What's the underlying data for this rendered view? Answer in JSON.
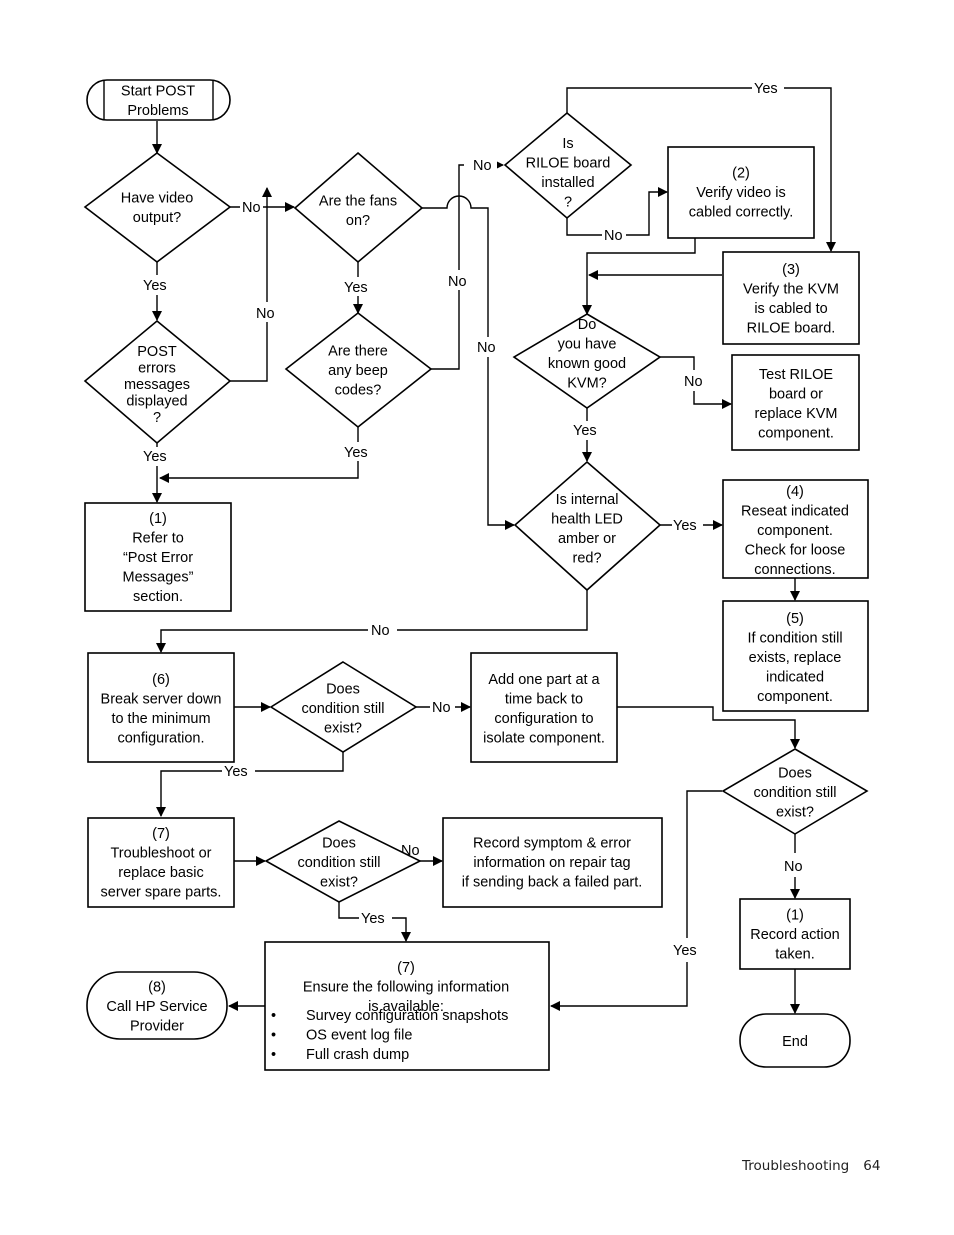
{
  "nodes": {
    "start": {
      "type": "terminator",
      "lines": [
        "Start POST",
        "Problems"
      ]
    },
    "q_video": {
      "type": "decision",
      "lines": [
        "Have video",
        "output?"
      ]
    },
    "q_fans": {
      "type": "decision",
      "lines": [
        "Are the fans",
        "on?"
      ]
    },
    "q_riloe": {
      "type": "decision",
      "lines": [
        "Is",
        "RILOE board",
        "installed",
        "?"
      ]
    },
    "step2": {
      "type": "process",
      "lines": [
        "(2)",
        "Verify video is",
        "cabled correctly."
      ]
    },
    "step3": {
      "type": "process",
      "lines": [
        "(3)",
        "Verify the KVM",
        "is cabled to",
        "RILOE board."
      ]
    },
    "q_post_errors": {
      "type": "decision",
      "lines": [
        "POST",
        "errors",
        "messages",
        "displayed",
        "?"
      ]
    },
    "q_beep": {
      "type": "decision",
      "lines": [
        "Are there",
        "any beep",
        "codes?"
      ]
    },
    "q_kvm": {
      "type": "decision",
      "lines": [
        "Do",
        "you have",
        "known good",
        "KVM?"
      ]
    },
    "test_riloe": {
      "type": "process",
      "lines": [
        "Test RILOE",
        "board or",
        "replace KVM",
        "component."
      ]
    },
    "step1_refer": {
      "type": "process",
      "lines": [
        "(1)",
        "Refer to",
        "“Post Error",
        "Messages”",
        "section."
      ]
    },
    "q_led": {
      "type": "decision",
      "lines": [
        "Is internal",
        "health LED",
        "amber or",
        "red?"
      ]
    },
    "step4": {
      "type": "process",
      "lines": [
        "(4)",
        "Reseat indicated",
        "component.",
        "Check for loose",
        "connections."
      ]
    },
    "step5": {
      "type": "process",
      "lines": [
        "(5)",
        "If condition still",
        "exists, replace",
        "indicated",
        "component."
      ]
    },
    "step6": {
      "type": "process",
      "lines": [
        "(6)",
        "Break server down",
        "to the minimum",
        "configuration."
      ]
    },
    "q_cond1": {
      "type": "decision",
      "lines": [
        "Does",
        "condition still",
        "exist?"
      ]
    },
    "add_part": {
      "type": "process",
      "lines": [
        "Add one part at a",
        "time back to",
        "configuration to",
        "isolate component."
      ]
    },
    "q_cond2": {
      "type": "decision",
      "lines": [
        "Does",
        "condition still",
        "exist?"
      ]
    },
    "step7_troubleshoot": {
      "type": "process",
      "lines": [
        "(7)",
        "Troubleshoot or",
        "replace basic",
        "server spare parts."
      ]
    },
    "q_cond3": {
      "type": "decision",
      "lines": [
        "Does",
        "condition still",
        "exist?"
      ]
    },
    "record_symptom": {
      "type": "process",
      "lines": [
        "Record symptom & error",
        "information on repair tag",
        "if sending back a failed part."
      ]
    },
    "step1_record": {
      "type": "process",
      "lines": [
        "(1)",
        "Record action",
        "taken."
      ]
    },
    "step7_ensure": {
      "type": "process",
      "lines": [
        "(7)",
        "Ensure the following information",
        "is available:"
      ],
      "bullets": [
        "Survey configuration snapshots",
        "OS event log file",
        "Full crash dump"
      ]
    },
    "step8": {
      "type": "terminator",
      "lines": [
        "(8)",
        "Call HP Service",
        "Provider"
      ]
    },
    "end": {
      "type": "terminator",
      "lines": [
        "End"
      ]
    }
  },
  "edge_labels": {
    "yes": "Yes",
    "no": "No"
  },
  "footer": {
    "section": "Troubleshooting",
    "page": "64"
  }
}
